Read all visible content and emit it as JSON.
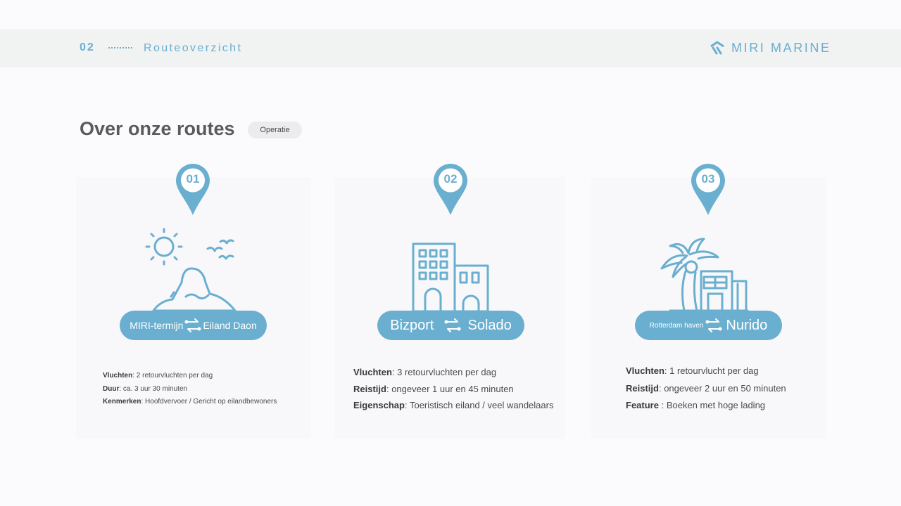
{
  "header": {
    "section_number": "02",
    "section_title": "Routeoverzicht",
    "brand_name": "MIRI MARINE"
  },
  "main": {
    "title": "Over onze routes",
    "tag": "Operatie"
  },
  "routes": [
    {
      "number": "01",
      "from": "MIRI-termijn",
      "to": "Eiland Daon",
      "details": [
        {
          "label": "Vluchten",
          "sep": ": ",
          "value": "2 retourvluchten per dag"
        },
        {
          "label": "Duur",
          "sep": ": ",
          "value": "ca. 3 uur 30 minuten"
        },
        {
          "label": "Kenmerken",
          "sep": ": ",
          "value": "Hoofdvervoer / Gericht op eilandbewoners"
        }
      ]
    },
    {
      "number": "02",
      "from": "Bizport",
      "to": "Solado",
      "details": [
        {
          "label": "Vluchten",
          "sep": ": ",
          "value": "3 retourvluchten per dag"
        },
        {
          "label": "Reistijd",
          "sep": ": ",
          "value": "ongeveer 1 uur en 45 minuten"
        },
        {
          "label": "Eigenschap",
          "sep": ": ",
          "value": "Toeristisch eiland / veel wandelaars"
        }
      ]
    },
    {
      "number": "03",
      "from": "Rotterdam haven",
      "to": "Nurido",
      "details": [
        {
          "label": "Vluchten",
          "sep": ": ",
          "value": "1 retourvlucht per dag"
        },
        {
          "label": "Reistijd",
          "sep": ": ",
          "value": "ongeveer 2 uur en 50 minuten"
        },
        {
          "label": "Feature",
          "sep": " : ",
          "value": "Boeken met hoge lading"
        }
      ]
    }
  ],
  "colors": {
    "accent": "#6aafd0",
    "text": "#5a5a5c",
    "header_bg": "#f1f2f2",
    "card_bg": "#f8f8fa"
  },
  "icons": [
    "brand-logo-icon",
    "location-pin-icon",
    "island-volcano-icon",
    "city-buildings-icon",
    "palm-tree-house-icon",
    "swap-arrows-icon"
  ]
}
